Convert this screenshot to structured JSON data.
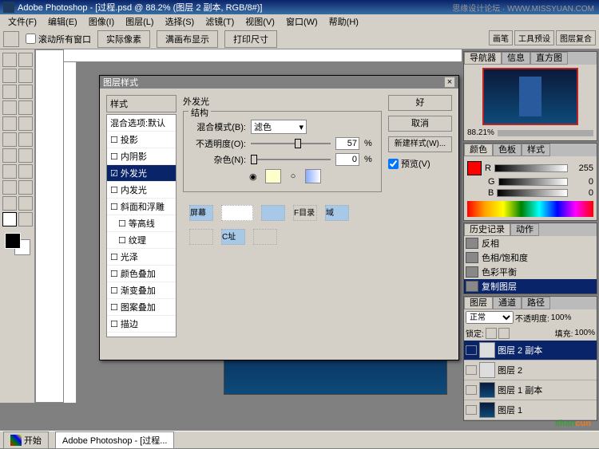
{
  "title": "Adobe Photoshop - [过程.psd @ 88.2% (图层 2 副本, RGB/8#)]",
  "top_right": "思缘设计论坛 · WWW.MISSYUAN.COM",
  "menubar": [
    "文件(F)",
    "编辑(E)",
    "图像(I)",
    "图层(L)",
    "选择(S)",
    "滤镜(T)",
    "视图(V)",
    "窗口(W)",
    "帮助(H)"
  ],
  "options": {
    "scroll_all": "滚动所有窗口",
    "actual_pixels": "实际像素",
    "fit_screen": "满画布显示",
    "print_size": "打印尺寸"
  },
  "right_top_tabs": [
    "画笔",
    "工具预设",
    "图层复合"
  ],
  "dialog": {
    "title": "图层样式",
    "left_head": "样式",
    "blend_default": "混合选项:默认",
    "styles": [
      "投影",
      "内阴影",
      "外发光",
      "内发光",
      "斜面和浮雕",
      "等高线",
      "纹理",
      "光泽",
      "颜色叠加",
      "渐变叠加",
      "图案叠加",
      "描边"
    ],
    "selected": "外发光",
    "section_title": "外发光",
    "structure": "结构",
    "blend_mode_lbl": "混合模式(B):",
    "blend_mode_val": "滤色",
    "opacity_lbl": "不透明度(O):",
    "opacity_val": "57",
    "noise_lbl": "杂色(N):",
    "noise_val": "0",
    "pct": "%",
    "btn_ok": "好",
    "btn_cancel": "取消",
    "btn_new": "新建样式(W)...",
    "preview": "预览(V)",
    "frag_labels": [
      "屏幕",
      "F目录",
      "域",
      "C址"
    ]
  },
  "navigator": {
    "tabs": [
      "导航器",
      "信息",
      "直方图"
    ],
    "zoom": "88.21%"
  },
  "color_panel": {
    "tabs": [
      "颜色",
      "色板",
      "样式"
    ],
    "r": "R",
    "g": "G",
    "b": "B",
    "val": "255"
  },
  "history": {
    "tabs": [
      "历史记录",
      "动作"
    ],
    "items": [
      "反相",
      "色相/饱和度",
      "色彩平衡",
      "复制图层"
    ]
  },
  "layers": {
    "tabs": [
      "图层",
      "通道",
      "路径"
    ],
    "mode": "正常",
    "opacity_lbl": "不透明度:",
    "opacity_val": "100%",
    "lock_lbl": "锁定:",
    "fill_lbl": "填充:",
    "fill_val": "100%",
    "items": [
      "图层 2 副本",
      "图层 2",
      "图层 1 副本",
      "图层 1"
    ]
  },
  "taskbar": {
    "start": "开始",
    "app": "Adobe Photoshop - [过程..."
  },
  "watermark": {
    "a": "shan",
    "b": "cun"
  }
}
